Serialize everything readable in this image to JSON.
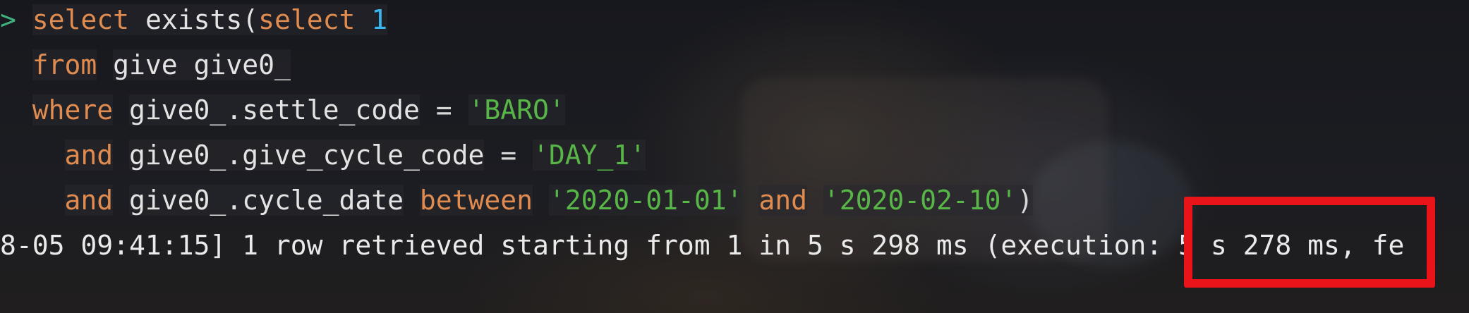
{
  "query": {
    "line1": {
      "prompt": ">",
      "kw_select": "select",
      "fn_exists": "exists(",
      "kw_select2": "select",
      "num": "1"
    },
    "line2": {
      "kw_from": "from",
      "table": "give give0_"
    },
    "line3": {
      "kw_where": "where",
      "col": "give0_.settle_code",
      "op": "=",
      "value": "'BARO'"
    },
    "line4": {
      "kw_and": "and",
      "col": "give0_.give_cycle_code",
      "op": "=",
      "value": "'DAY_1'"
    },
    "line5": {
      "kw_and": "and",
      "col": "give0_.cycle_date",
      "kw_between": "between",
      "value_start": "'2020-01-01'",
      "kw_and2": "and",
      "value_end": "'2020-02-10'",
      "close": ")"
    }
  },
  "log": {
    "text": "8-05 09:41:15] 1 row retrieved starting from 1 in 5 s 298 ms (execution: 5 s 278 ms, fe"
  },
  "colors": {
    "keyword": "#e08b4f",
    "string": "#58b548",
    "number": "#37b6f0",
    "prompt": "#3fb27f",
    "highlight": "#e8141a"
  }
}
